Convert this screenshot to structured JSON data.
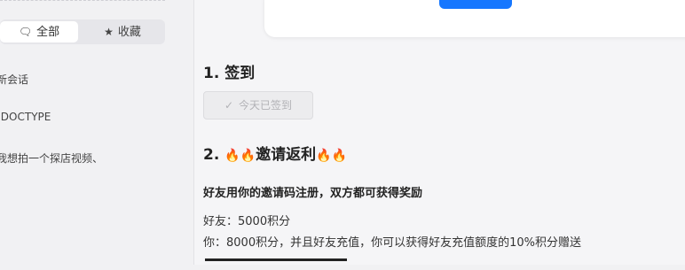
{
  "sidebar": {
    "tabs": [
      {
        "label": "全部",
        "icon": "chat-icon"
      },
      {
        "label": "收藏",
        "icon": "star-icon"
      }
    ],
    "conversations": [
      "新会话",
      "!DOCTYPE",
      "我想拍一个探店视频、"
    ]
  },
  "main": {
    "section1_title": "1. 签到",
    "signed_button": "今天已签到",
    "section2_prefix": "2. ",
    "section2_title": "邀请返利",
    "invite_headline": "好友用你的邀请码注册，双方都可获得奖励",
    "friend_reward": "好友：5000积分",
    "your_reward": "你：8000积分，并且好友充值，你可以获得好友充值额度的10%积分赠送"
  },
  "colors": {
    "accent": "#1677ff"
  }
}
